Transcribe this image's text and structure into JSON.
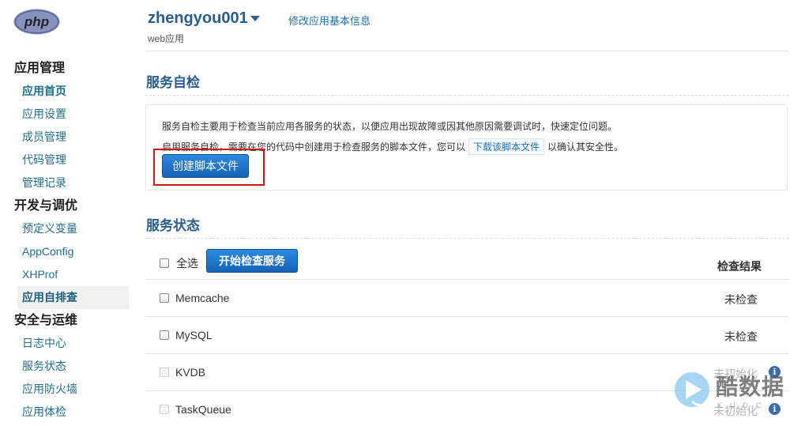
{
  "logo": {
    "text": "php"
  },
  "header": {
    "app_name": "zhengyou001",
    "app_type": "web应用",
    "edit_link": "修改应用基本信息"
  },
  "sidebar": {
    "sections": [
      {
        "title": "应用管理",
        "items": [
          "应用首页",
          "应用设置",
          "成员管理",
          "代码管理",
          "管理记录"
        ]
      },
      {
        "title": "开发与调优",
        "items": [
          "预定义变量",
          "AppConfig",
          "XHProf",
          "应用自排查"
        ]
      },
      {
        "title": "安全与运维",
        "items": [
          "日志中心",
          "服务状态",
          "应用防火墙",
          "应用体检"
        ]
      }
    ],
    "active_item": "应用自排查"
  },
  "self_check": {
    "title": "服务自检",
    "desc1": "服务自检主要用于检查当前应用各服务的状态，以便应用出现故障或因其他原因需要调试时，快速定位问题。",
    "desc2_before": "启用服务自检，需要在您的代码中创建用于检查服务的脚本文件，您可以",
    "download_link": "下载该脚本文件",
    "desc2_after": "以确认其安全性。",
    "create_button": "创建脚本文件"
  },
  "service_status": {
    "title": "服务状态",
    "select_all": "全选",
    "start_button": "开始检查服务",
    "result_header": "检查结果",
    "rows": [
      {
        "name": "Memcache",
        "status": "未检查",
        "enabled": true
      },
      {
        "name": "MySQL",
        "status": "未检查",
        "enabled": true
      },
      {
        "name": "KVDB",
        "status": "未初始化",
        "enabled": false
      },
      {
        "name": "TaskQueue",
        "status": "未初始化",
        "enabled": false
      }
    ]
  },
  "watermark": {
    "text": "酷数据",
    "sub": "KUDC"
  },
  "colors": {
    "accent": "#2a5e8e",
    "button": "#1c74cc",
    "highlight": "#d01616",
    "link": "#1f6fb3"
  }
}
